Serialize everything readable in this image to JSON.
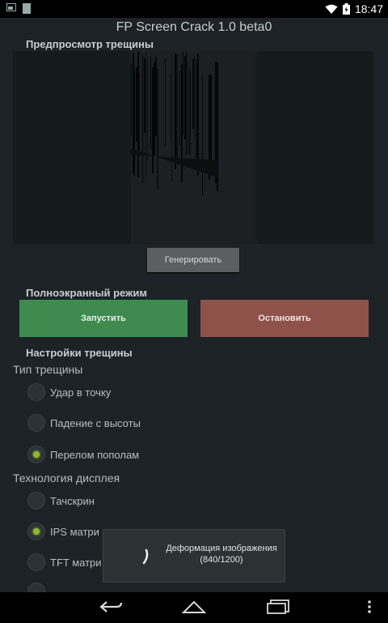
{
  "status_bar": {
    "time": "18:47",
    "icons": [
      "image-notification-icon",
      "file-notification-icon",
      "wifi-icon",
      "battery-icon"
    ]
  },
  "app": {
    "title": "FP Screen Crack  1.0 beta0"
  },
  "preview_section": {
    "header": "Предпросмотр трещины",
    "generate_button": "Генерировать"
  },
  "fullscreen_section": {
    "header": "Полноэкранный режим",
    "start_button": "Запустить",
    "stop_button": "Остановить",
    "start_color": "#3f8a4f",
    "stop_color": "#8f524a"
  },
  "crack_settings": {
    "header": "Настройки трещины",
    "crack_type": {
      "label": "Тип трещины",
      "options": [
        "Удар в точку",
        "Падение с высоты",
        "Перелом пополам"
      ],
      "selected": "Перелом пополам"
    },
    "display_tech": {
      "label": "Технология дисплея",
      "options": [
        "Тачскрин",
        "IPS матри",
        "TFT матри"
      ],
      "selected": "IPS матри"
    }
  },
  "toast": {
    "line1": "Деформация изображения",
    "line2": "(840/1200)"
  },
  "nav_bar": {
    "buttons": [
      "back-icon",
      "home-icon",
      "recents-icon",
      "overflow-menu-icon"
    ]
  },
  "accent_color": "#8fb830"
}
